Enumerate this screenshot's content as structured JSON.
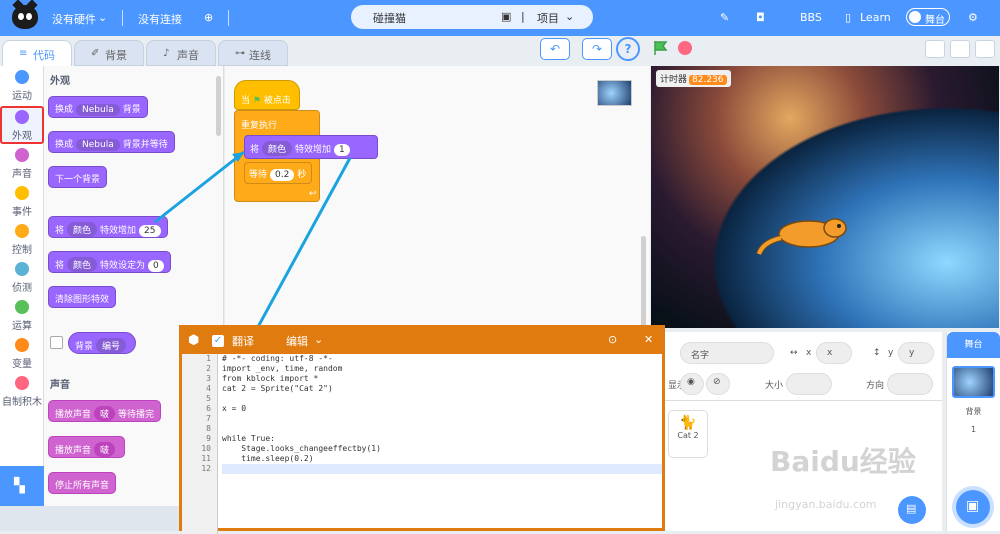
{
  "topbar": {
    "hardware": "没有硬件",
    "connection": "没有连接",
    "project_name": "碰撞猫",
    "project_menu": "项目",
    "bbs": "BBS",
    "learn": "Learn",
    "stage_toggle": "舞台"
  },
  "tabs": {
    "code": "代码",
    "backdrop": "背景",
    "sound": "声音",
    "wiring": "连线"
  },
  "categories": [
    {
      "label": "运动",
      "color": "#4c97ff"
    },
    {
      "label": "外观",
      "color": "#9966ff"
    },
    {
      "label": "声音",
      "color": "#cf63cf"
    },
    {
      "label": "事件",
      "color": "#ffbf00"
    },
    {
      "label": "控制",
      "color": "#ffab19"
    },
    {
      "label": "侦测",
      "color": "#5cb1d6"
    },
    {
      "label": "运算",
      "color": "#59c059"
    },
    {
      "label": "变量",
      "color": "#ff8c1a"
    },
    {
      "label": "自制积木",
      "color": "#ff6680"
    }
  ],
  "palette": {
    "looks_title": "外观",
    "b1_a": "换成",
    "b1_dd": "Nebula",
    "b1_b": "背景",
    "b2_a": "换成",
    "b2_dd": "Nebula",
    "b2_b": "背景并等待",
    "b3": "下一个背景",
    "b4_a": "将",
    "b4_dd": "颜色",
    "b4_b": "特效增加",
    "b4_v": "25",
    "b5_a": "将",
    "b5_dd": "颜色",
    "b5_b": "特效设定为",
    "b5_v": "0",
    "b6": "清除图形特效",
    "b7_a": "背景",
    "b7_dd": "编号",
    "sound_title": "声音",
    "s1_a": "播放声音",
    "s1_dd": "啵",
    "s1_b": "等待播完",
    "s2_a": "播放声音",
    "s2_dd": "啵",
    "s3": "停止所有声音"
  },
  "script": {
    "hat_a": "当",
    "hat_b": "被点击",
    "forever": "重复执行",
    "eff_a": "将",
    "eff_dd": "颜色",
    "eff_b": "特效增加",
    "eff_v": "1",
    "wait_a": "等待",
    "wait_v": "0.2",
    "wait_b": "秒"
  },
  "stage": {
    "timer_label": "计时器",
    "timer_value": "82.236"
  },
  "sprite_info": {
    "name_placeholder": "名字",
    "x_label": "x",
    "x_value": "x",
    "y_label": "y",
    "y_value": "y",
    "show_label": "显示",
    "size_label": "大小",
    "direction_label": "方向",
    "sprite_name": "Cat 2"
  },
  "stage_panel": {
    "title": "舞台",
    "backdrop_label": "背景",
    "backdrop_count": "1"
  },
  "code_window": {
    "translate": "翻译",
    "edit": "编辑",
    "line_numbers": [
      "1",
      "2",
      "3",
      "4",
      "5",
      "6",
      "7",
      "8",
      "9",
      "10",
      "11",
      "12"
    ],
    "lines": [
      "# -*- coding: utf-8 -*-",
      "import _env, time, random",
      "from kblock import *",
      "cat 2 = Sprite(\"Cat 2\")",
      "",
      "x = 0",
      "",
      "",
      "while True:",
      "    Stage.looks_changeeffectby(1)",
      "    time.sleep(0.2)",
      ""
    ]
  },
  "watermark": {
    "main": "Baidu经验",
    "url": "jingyan.baidu.com"
  }
}
